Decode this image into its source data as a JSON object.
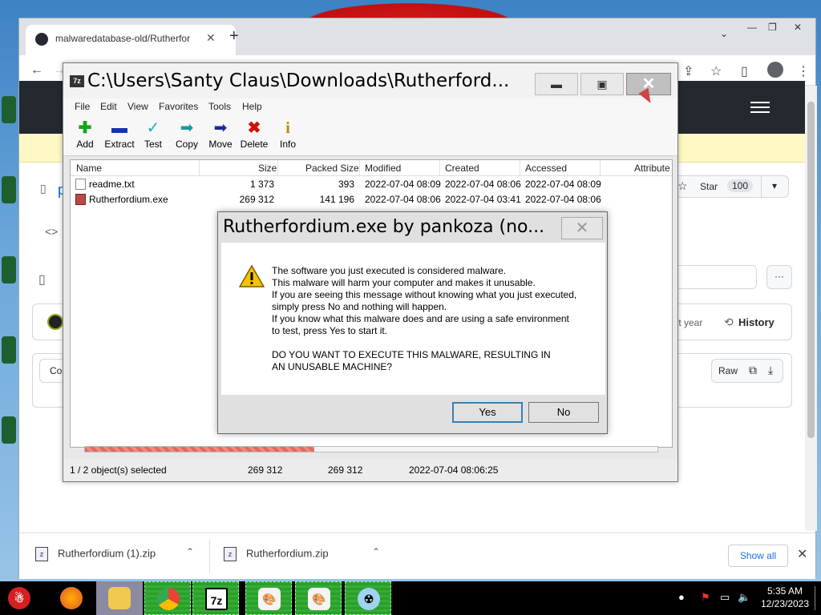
{
  "browser": {
    "tab_title": "malwaredatabase-old/Rutherfor",
    "new_tab_symbol": "+"
  },
  "github": {
    "star_label": "Star",
    "star_count": "100",
    "last_commit_text": "last year",
    "history_label": "History",
    "raw_label": "Raw",
    "left_partial_1": "p",
    "left_partial_2": "Co"
  },
  "downloads": {
    "items": [
      {
        "name": "Rutherfordium (1).zip"
      },
      {
        "name": "Rutherfordium.zip"
      }
    ],
    "show_all": "Show all"
  },
  "sevenzip": {
    "title": "C:\\Users\\Santy Claus\\Downloads\\Rutherford...",
    "menu": [
      "File",
      "Edit",
      "View",
      "Favorites",
      "Tools",
      "Help"
    ],
    "toolbar": [
      "Add",
      "Extract",
      "Test",
      "Copy",
      "Move",
      "Delete",
      "Info"
    ],
    "columns": [
      "Name",
      "Size",
      "Packed Size",
      "Modified",
      "Created",
      "Accessed",
      "Attribute"
    ],
    "rows": [
      {
        "name": "readme.txt",
        "size": "1 373",
        "packed": "393",
        "modified": "2022-07-04 08:09",
        "created": "2022-07-04 08:06",
        "accessed": "2022-07-04 08:09"
      },
      {
        "name": "Rutherfordium.exe",
        "size": "269 312",
        "packed": "141 196",
        "modified": "2022-07-04 08:06",
        "created": "2022-07-04 03:41",
        "accessed": "2022-07-04 08:06"
      }
    ],
    "progress_fraction": 0.4,
    "status": {
      "selected": "1 / 2 object(s) selected",
      "size": "269 312",
      "packed": "269 312",
      "date": "2022-07-04 08:06:25"
    }
  },
  "dialog": {
    "title": "Rutherfordium.exe by pankoza (no...",
    "lines": [
      "The software you just executed is considered malware.",
      "This malware will harm your computer and makes it unusable.",
      "If you are seeing this message without knowing what you just executed,",
      "simply press No and nothing will happen.",
      "If you know what this malware does and are using a safe environment",
      "to test, press Yes to start it."
    ],
    "question": "DO YOU WANT TO EXECUTE THIS MALWARE, RESULTING IN AN UNUSABLE MACHINE?",
    "yes_label": "Yes",
    "no_label": "No"
  },
  "taskbar": {
    "sevenzip_icon": "7z",
    "time": "5:35 AM",
    "date": "12/23/2023"
  },
  "colors": {
    "progress": "#e06860",
    "taskbar_active": "#2c9d2c",
    "github_header": "#24292f"
  }
}
